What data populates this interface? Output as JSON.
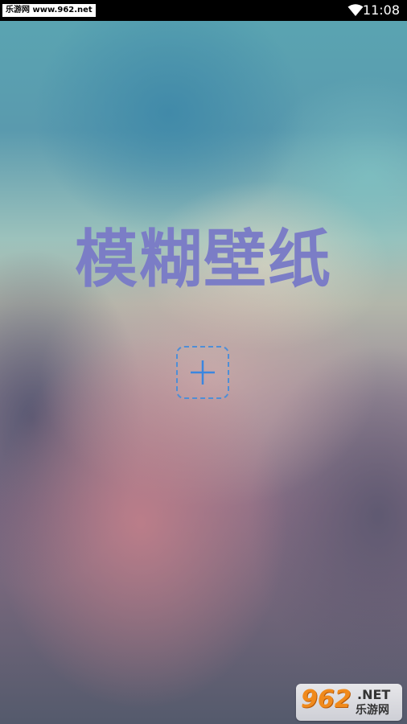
{
  "status_bar": {
    "watermark_text": "乐游网 www.962.net",
    "time": "11:08",
    "icons": [
      "wifi-icon"
    ]
  },
  "main": {
    "title": "模糊壁纸",
    "add_button": {
      "icon": "plus-icon"
    }
  },
  "watermark": {
    "number": "962",
    "net": ".NET",
    "name": "乐游网"
  },
  "colors": {
    "title": "#7b7dc6",
    "add_button_border": "#4f8ed6",
    "plus": "#3a86e0",
    "logo_orange": "#f08a1c"
  }
}
